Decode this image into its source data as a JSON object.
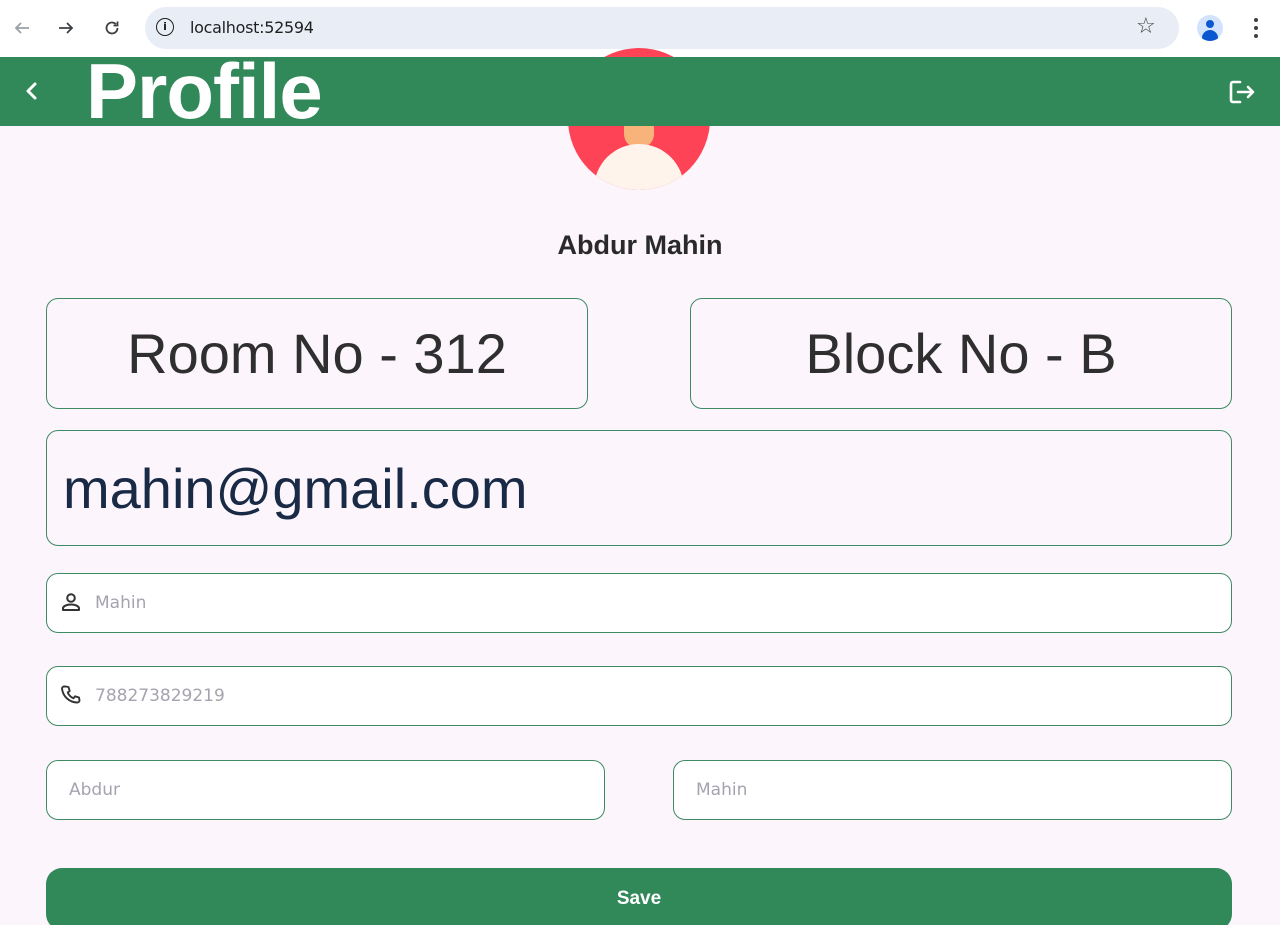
{
  "browser": {
    "url": "localhost:52594",
    "icons": {
      "back": "arrow-left-icon",
      "forward": "arrow-right-icon",
      "reload": "reload-icon",
      "info": "info-icon",
      "bookmark": "star-icon",
      "profile": "account-icon",
      "menu": "kebab-icon"
    }
  },
  "appbar": {
    "title": "Profile",
    "background": "#318859",
    "back_icon": "chevron-left-icon",
    "logout_icon": "logout-icon"
  },
  "profile": {
    "name": "Abdur Mahin",
    "avatar_color": "#ff4356"
  },
  "cards": {
    "room": "Room No - 312",
    "block": "Block No - B",
    "email": "mahin@gmail.com"
  },
  "form": {
    "username_placeholder": "Mahin",
    "phone_placeholder": "788273829219",
    "first_name_placeholder": "Abdur",
    "last_name_placeholder": "Mahin"
  },
  "actions": {
    "save_label": "Save"
  }
}
